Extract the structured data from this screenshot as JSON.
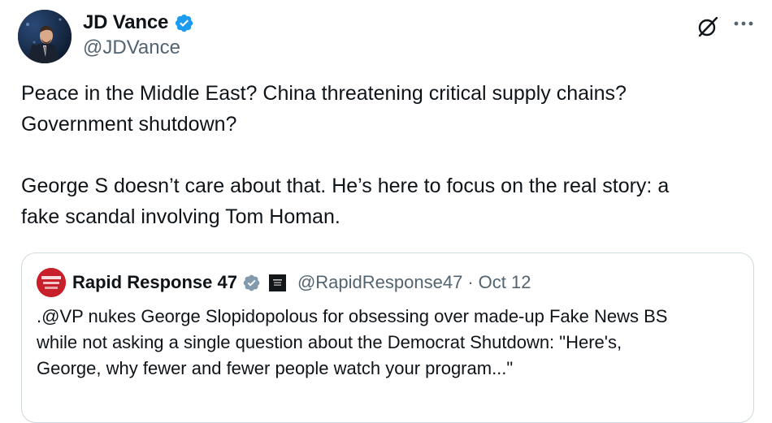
{
  "author": {
    "name": "JD Vance",
    "handle": "@JDVance",
    "verified": true
  },
  "icons": {
    "grok": "grok-slash-icon",
    "more": "more-icon",
    "verified": "verified-badge-icon",
    "affiliate": "affiliate-badge-icon"
  },
  "colors": {
    "verified_blue": "#1d9bf0",
    "text_primary": "#0f1419",
    "text_secondary": "#536471",
    "border": "#cfd9de"
  },
  "tweet": {
    "line1": "Peace in the Middle East? China threatening critical supply chains?",
    "line2": "Government shutdown?",
    "line3": "George S doesn’t care about that. He’s here to focus on the real story: a",
    "line4": "fake scandal involving Tom Homan."
  },
  "quote": {
    "name": "Rapid Response 47",
    "handle": "@RapidResponse47",
    "separator": "·",
    "date": "Oct 12",
    "text_line1": ".@VP nukes George Slopidopolous for obsessing over made-up Fake News BS",
    "text_line2": "while not asking a single question about the Democrat Shutdown: \"Here's,",
    "text_line3": "George, why fewer and fewer people watch your program...\""
  }
}
